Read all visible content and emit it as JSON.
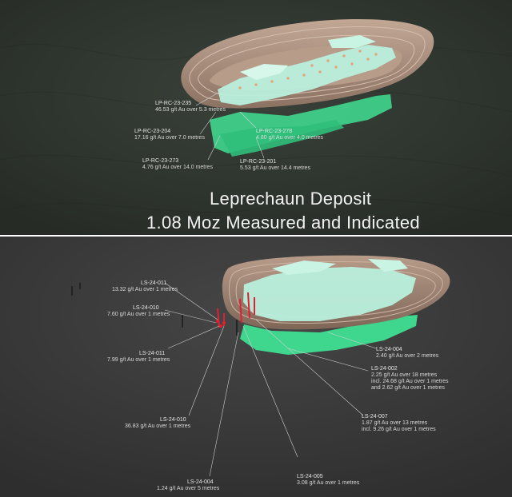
{
  "top": {
    "title_line1": "Leprechaun Deposit",
    "title_line2": "1.08 Moz Measured and Indicated",
    "labels": [
      {
        "hole": "LP-RC-23-235",
        "grade": "46.53 g/t Au over 5.3 metres"
      },
      {
        "hole": "LP-RC-23-204",
        "grade": "17.16 g/t Au over 7.0 metres"
      },
      {
        "hole": "LP-RC-23-278",
        "grade": "4.80 g/t Au over 4.0 metres"
      },
      {
        "hole": "LP-RC-23-273",
        "grade": "4.76 g/t Au over 14.0 metres"
      },
      {
        "hole": "LP-RC-23-201",
        "grade": "5.53 g/t Au over 14.4 metres"
      }
    ]
  },
  "bottom": {
    "labels": [
      {
        "hole": "LS-24-011",
        "lines": [
          "13.32 g/t Au over 1 metres"
        ]
      },
      {
        "hole": "LS-24-010",
        "lines": [
          "7.60 g/t Au over 1 metres"
        ]
      },
      {
        "hole": "LS-24-011",
        "lines": [
          "7.99 g/t Au over 1 metres"
        ]
      },
      {
        "hole": "LS-24-010",
        "lines": [
          "36.83 g/t Au over 1 metres"
        ]
      },
      {
        "hole": "LS-24-004",
        "lines": [
          "1.24 g/t Au over 5 metres"
        ]
      },
      {
        "hole": "LS-24-005",
        "lines": [
          "3.08 g/t Au over 1 metres"
        ]
      },
      {
        "hole": "LS-24-007",
        "lines": [
          "1.87 g/t Au over 13 metres",
          "incl. 9.26 g/t Au over 1 metres"
        ]
      },
      {
        "hole": "LS-24-002",
        "lines": [
          "2.25 g/t Au over 18 metres",
          "incl. 24.68 g/t Au over 1 metres",
          "and 2.62 g/t Au over 1 metres"
        ]
      },
      {
        "hole": "LS-24-004",
        "lines": [
          "2.40 g/t Au over 2 metres"
        ]
      }
    ]
  },
  "colors": {
    "pit_shell": "#a88d7a",
    "orebody_light": "#b8efdc",
    "orebody_green": "#3fd68e",
    "drill_red": "#e02030",
    "terrain": "#2f352f"
  }
}
